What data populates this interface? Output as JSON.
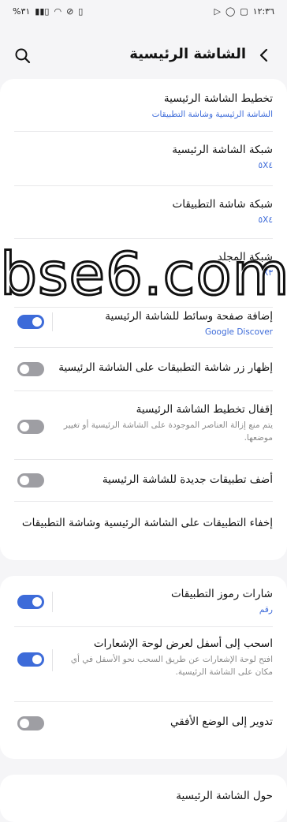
{
  "statusbar": {
    "time": "١٢:٣٦",
    "battery": "%٣١"
  },
  "header": {
    "title": "الشاشة الرئيسية",
    "back_icon": "chevron-left-icon",
    "search_icon": "search-icon"
  },
  "section1": {
    "items": [
      {
        "title": "تخطيط الشاشة الرئيسية",
        "subtitle": "الشاشة الرئيسية وشاشة التطبيقات"
      },
      {
        "title": "شبكة الشاشة الرئيسية",
        "subtitle": "٥X٤"
      },
      {
        "title": "شبكة شاشة التطبيقات",
        "subtitle": "٥X٤"
      },
      {
        "title": "شبكة المجلد",
        "subtitle": "٤X٣"
      },
      {
        "title": "إضافة صفحة وسائط للشاشة الرئيسية",
        "subtitle": "Google Discover",
        "toggle": true
      },
      {
        "title": "إظهار زر شاشة التطبيقات على الشاشة الرئيسية",
        "toggle": false
      },
      {
        "title": "إقفال تخطيط الشاشة الرئيسية",
        "subtitle": "يتم منع إزالة العناصر الموجودة على الشاشة الرئيسية أو تغيير موضعها.",
        "toggle": false
      },
      {
        "title": "أضف تطبيقات جديدة للشاشة الرئيسية",
        "toggle": false
      },
      {
        "title": "إخفاء التطبيقات على الشاشة الرئيسية وشاشة التطبيقات"
      }
    ]
  },
  "section2": {
    "items": [
      {
        "title": "شارات رموز التطبيقات",
        "subtitle": "رقم",
        "toggle": true
      },
      {
        "title": "اسحب إلى أسفل لعرض لوحة الإشعارات",
        "subtitle": "افتح لوحة الإشعارات عن طريق السحب نحو الأسفل في أي مكان على الشاشة الرئيسية.",
        "toggle": true
      },
      {
        "title": "تدوير إلى الوضع الأفقي",
        "toggle": false
      }
    ]
  },
  "section3": {
    "items": [
      {
        "title": "حول الشاشة الرئيسية"
      }
    ]
  },
  "watermark": "bse6.com"
}
